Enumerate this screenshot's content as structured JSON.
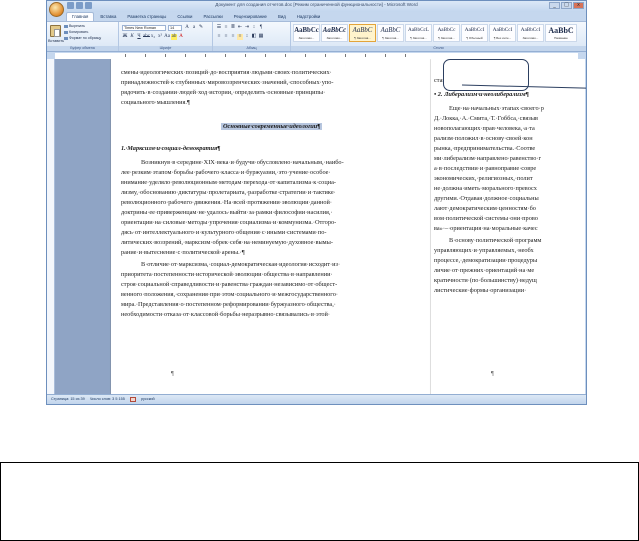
{
  "window": {
    "title": "Документ для создания отчетов.doc [Режим ограниченной функциональности] - Microsoft Word",
    "controls": [
      "_",
      "□",
      "x"
    ]
  },
  "tabs": [
    "Главная",
    "Вставка",
    "Разметка страницы",
    "Ссылки",
    "Рассылки",
    "Рецензирование",
    "Вид",
    "Надстройки"
  ],
  "ribbon": {
    "clipboard": {
      "paste": "Вставить",
      "cut": "Вырезать",
      "copy": "Копировать",
      "format_painter": "Формат по образцу",
      "label": "Буфер обмена"
    },
    "font": {
      "name": "Times New Roman",
      "size": "14",
      "label": "Шрифт"
    },
    "paragraph": {
      "label": "Абзац"
    },
    "styles": {
      "label": "Стили",
      "tiles": [
        {
          "sample": "AaBbCc",
          "name": "Заголово..."
        },
        {
          "sample": "AaBbCc",
          "name": "Заголово..."
        },
        {
          "sample": "AaBbC",
          "name": "¶ Заголов...",
          "selected": true
        },
        {
          "sample": "AaBbC",
          "name": "¶ Заголов..."
        },
        {
          "sample": "AaBbCcL",
          "name": "¶ Заголов..."
        },
        {
          "sample": "AaBbCc",
          "name": "¶ Заголов..."
        },
        {
          "sample": "AaBbCcI",
          "name": "¶ Обычный"
        },
        {
          "sample": "AaBbCcI",
          "name": "¶ Без инте..."
        },
        {
          "sample": "AaBbCcI",
          "name": "Заголово..."
        },
        {
          "sample": "AaBbC",
          "name": "Название"
        }
      ]
    }
  },
  "page1": {
    "lines": [
      "смены·идеологических·позиций·до·восприятия·людьми·своих·политических·",
      "принадлежностей·к·глубинных·мировоззренческих·значений,·способных·упо-",
      "рядочить·в·создании·людей·ход·истории,·определить·основные·принципы·",
      "социального·мышления.¶",
      "Основные·современные·идеологии¶",
      "1.·Марксизм·и·социал-демократия¶",
      "Возникнув·в·середине·XIX·века·и·будучи·обусловлено·начальным,·наибо-",
      "лее·резким·этапом·борьбы·рабочего·класса·и·буржуазии,·это·учение·особое·",
      "внимание·уделяло·революционным·методам·перехода·от·капитализма·к·социа-",
      "лизму,·обоснованию·диктатуры·пролетариата,·разработке·стратегии·и·тактике·",
      "революционного·рабочего·движения.·На·всей·протяжении·эволюции·данной·",
      "доктрины·ее·приверженцам·не·удалось·выйти·за·рамки·философии·насилия,·",
      "ориентации·на·силовые·методы·упрочения·социализма·и·коммунизма.·Отгоро-",
      "дясь·от·интеллектуального·и·культурного·общения·с·иными·системами·по-",
      "литических·воззрений,·марксизм·обрек·себя·на·немину­емую·духовное·вымы-",
      "рание·и·вытеснение·с·политической·арены.·¶",
      "В·отличие·от·марксизма,·социал-демократическая·идеология·исходит·из·",
      "приоритета·постепенности·исторической·эволюции·общества·в·направлении·",
      "строя·социальной·справедливости·и·равенства·граждан·независимо·от·общест-",
      "венного·положения,·сохранения·при·этом·социального·и·межгосударственного·",
      "мира.·Представления·о·постепенном·реформировании·буржуазного·общества,·",
      "необходимости·отказа·от·классовой·борьбы·неразрывно·связывались·в·этой·"
    ],
    "end_mark": "¶"
  },
  "page2": {
    "lines": [
      "стандарт",
      "• 2. Либерализм·и·неолиберализм¶",
      "Еще·на·начальных·этапах·своего·р",
      "Д.·Локка,·А.·Смита,·Т.·Гоббса,·связыв",
      "новополагающих·прав·человека,·а·та",
      "рализм·положил·в·основу·своей·кон",
      "рынка,·предпринимательства.·Соотве",
      "ми·либерализм·направлено·равенство·г",
      "а·в·последствии·и·равноправие·совре",
      "экономических,·религиозных,·полит",
      "не·должна·иметь·морального·превосх",
      "другими.·Отдавая·должное·социальны",
      "лают·демократическим·ценностям·бо",
      "вом·политической·системы·они·прово",
      "ва»·–·ориентация·на·моральные·качес",
      "В·основу·политической·программ",
      "управляющих·и·управляемых,·необх",
      "процессе,·демократизации·процедуры",
      "личие·от·прежних·ориентаций·на·ме",
      "кратичности·(по·большинству)·ведущ",
      "листические·формы·организации·"
    ],
    "end_mark": "¶"
  },
  "status": {
    "page": "Страница: 15 из 39",
    "words": "Число слов: 3 5 155",
    "language": "русский"
  },
  "colors": {
    "ribbon_bg": "#dce8f6",
    "window_border": "#6d8fbd",
    "workspace": "#8fa4c5",
    "highlight": "#b7c6df",
    "selected_style": "#e3a43a"
  }
}
